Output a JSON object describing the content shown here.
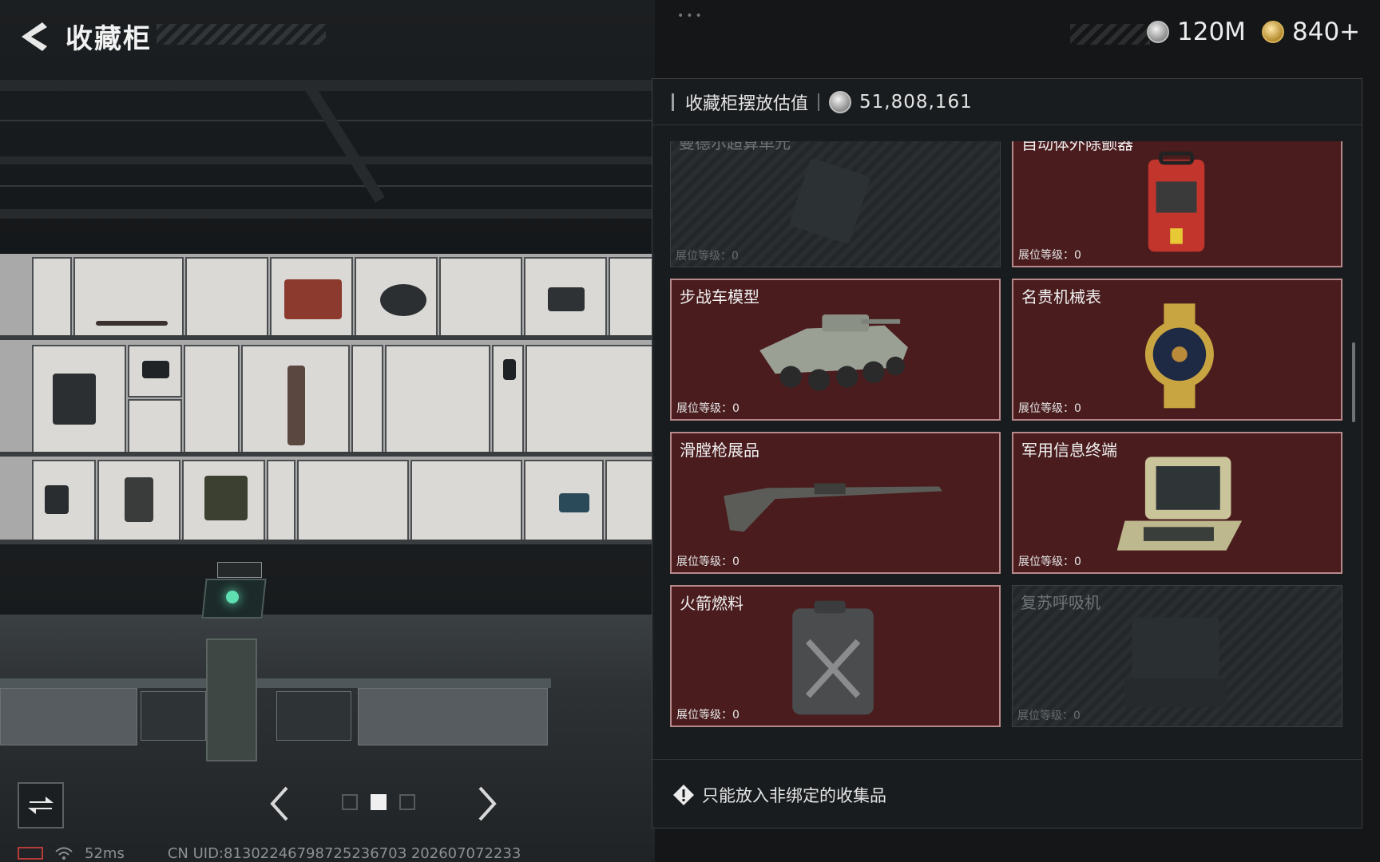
{
  "header": {
    "title": "收藏柜",
    "currencies": [
      {
        "icon": "silver-coin-icon",
        "value": "120M"
      },
      {
        "icon": "gold-coin-icon",
        "value": "840+"
      }
    ]
  },
  "panel": {
    "header_label": "收藏柜摆放估值",
    "header_value": "51,808,161",
    "cards": [
      {
        "name": "曼德尔超算单元",
        "level": "展位等级：0",
        "locked": true
      },
      {
        "name": "自动体外除颤器",
        "level": "展位等级：0",
        "locked": false
      },
      {
        "name": "步战车模型",
        "level": "展位等级：0",
        "locked": false
      },
      {
        "name": "名贵机械表",
        "level": "展位等级：0",
        "locked": false
      },
      {
        "name": "滑膛枪展品",
        "level": "展位等级：0",
        "locked": false
      },
      {
        "name": "军用信息终端",
        "level": "展位等级：0",
        "locked": false
      },
      {
        "name": "火箭燃料",
        "level": "展位等级：0",
        "locked": false
      },
      {
        "name": "复苏呼吸机",
        "level": "展位等级：0",
        "locked": true
      }
    ],
    "footer_note": "只能放入非绑定的收集品"
  },
  "status": {
    "ping": "52ms",
    "uid": "CN UID:8130224679872523670З 202607072233"
  },
  "colors": {
    "card_bg": "#4a1c1e",
    "card_border": "#b8898a",
    "panel_bg": "#1a1d1f"
  }
}
